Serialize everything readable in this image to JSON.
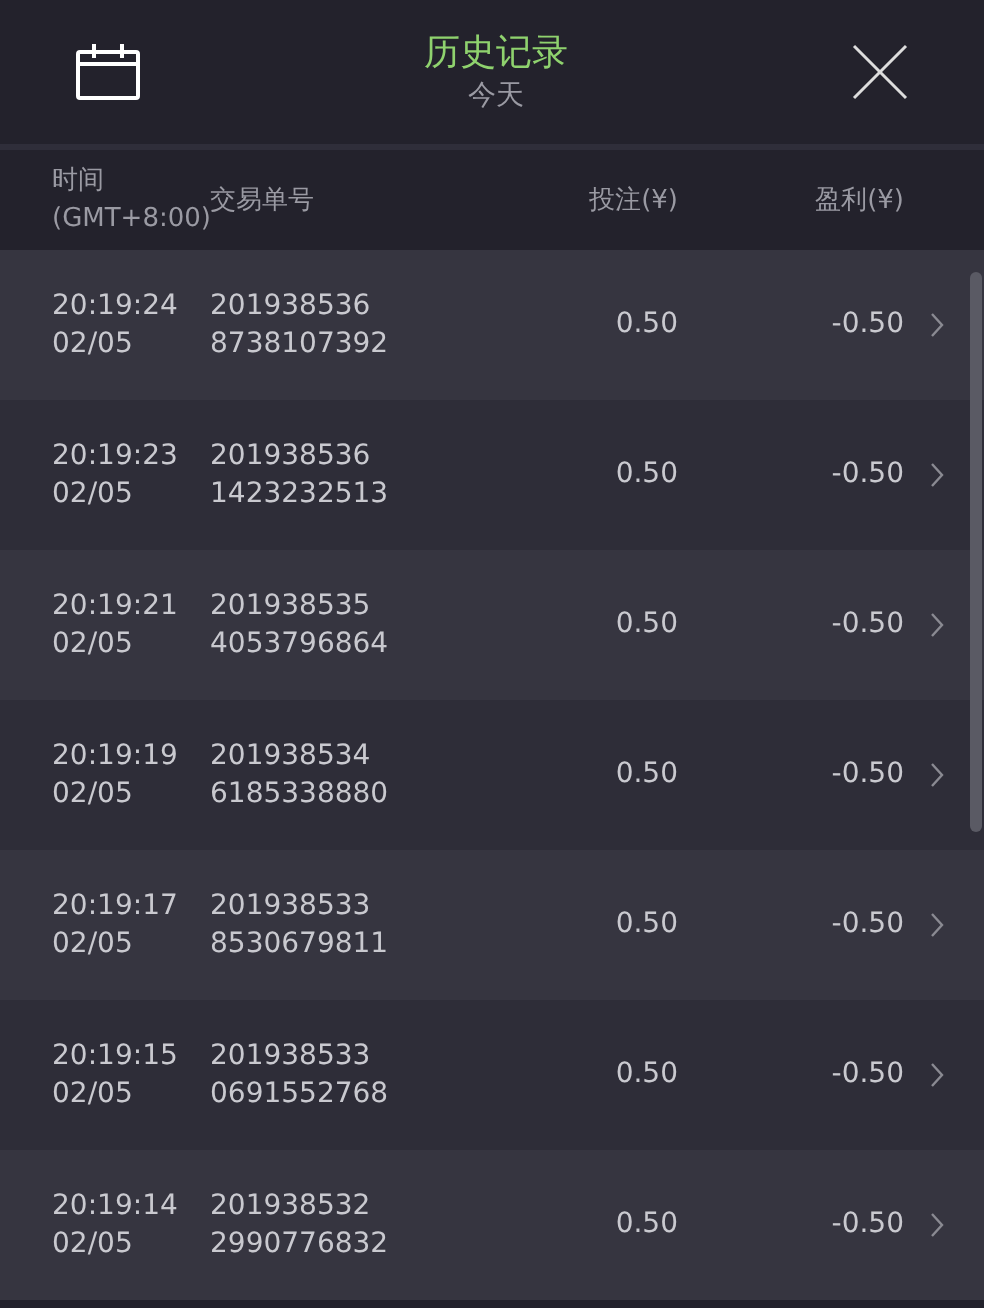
{
  "header": {
    "title": "历史记录",
    "subtitle": "今天"
  },
  "table": {
    "columns": [
      {
        "lines": [
          "时间",
          "(GMT+8:00)"
        ]
      },
      {
        "lines": [
          "交易单号"
        ]
      },
      {
        "lines": [
          "投注(¥)"
        ]
      },
      {
        "lines": [
          "盈利(¥)"
        ]
      }
    ],
    "rows": [
      {
        "time": "20:19:24",
        "date": "02/05",
        "order": [
          "201938536",
          "8738107392"
        ],
        "stake": "0.50",
        "profit": "-0.50"
      },
      {
        "time": "20:19:23",
        "date": "02/05",
        "order": [
          "201938536",
          "1423232513"
        ],
        "stake": "0.50",
        "profit": "-0.50"
      },
      {
        "time": "20:19:21",
        "date": "02/05",
        "order": [
          "201938535",
          "4053796864"
        ],
        "stake": "0.50",
        "profit": "-0.50"
      },
      {
        "time": "20:19:19",
        "date": "02/05",
        "order": [
          "201938534",
          "6185338880"
        ],
        "stake": "0.50",
        "profit": "-0.50"
      },
      {
        "time": "20:19:17",
        "date": "02/05",
        "order": [
          "201938533",
          "8530679811"
        ],
        "stake": "0.50",
        "profit": "-0.50"
      },
      {
        "time": "20:19:15",
        "date": "02/05",
        "order": [
          "201938533",
          "0691552768"
        ],
        "stake": "0.50",
        "profit": "-0.50"
      },
      {
        "time": "20:19:14",
        "date": "02/05",
        "order": [
          "201938532",
          "2990776832"
        ],
        "stake": "0.50",
        "profit": "-0.50"
      }
    ]
  }
}
